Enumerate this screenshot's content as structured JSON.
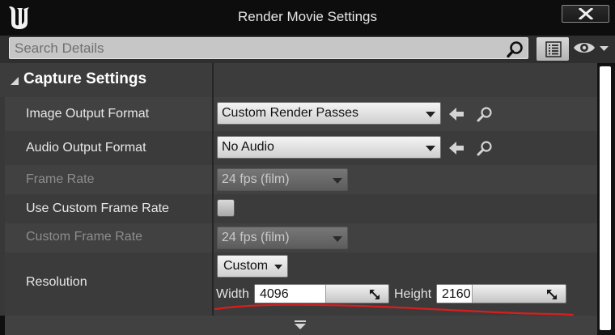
{
  "window": {
    "title": "Render Movie Settings",
    "logo_icon": "unreal-engine-logo",
    "close_icon": "close-icon"
  },
  "search": {
    "placeholder": "Search Details",
    "search_icon": "search-icon",
    "view_options_icon": "list-view-icon",
    "visibility_icon": "eye-icon"
  },
  "category": {
    "title": "Capture Settings",
    "expanded": true
  },
  "rows": {
    "image_output_format": {
      "label": "Image Output Format",
      "value": "Custom Render Passes",
      "enabled": true
    },
    "audio_output_format": {
      "label": "Audio Output Format",
      "value": "No Audio",
      "enabled": true
    },
    "frame_rate": {
      "label": "Frame Rate",
      "value": "24 fps (film)",
      "enabled": false
    },
    "use_custom_frame_rate": {
      "label": "Use Custom Frame Rate",
      "checked": false
    },
    "custom_frame_rate": {
      "label": "Custom Frame Rate",
      "value": "24 fps (film)",
      "enabled": false
    },
    "resolution": {
      "label": "Resolution",
      "preset": "Custom",
      "width_label": "Width",
      "width": "4096",
      "height_label": "Height",
      "height": "2160"
    }
  },
  "colors": {
    "annotation": "#d81e1e",
    "panel": "#414141",
    "title_bar": "#0d0d0d"
  }
}
